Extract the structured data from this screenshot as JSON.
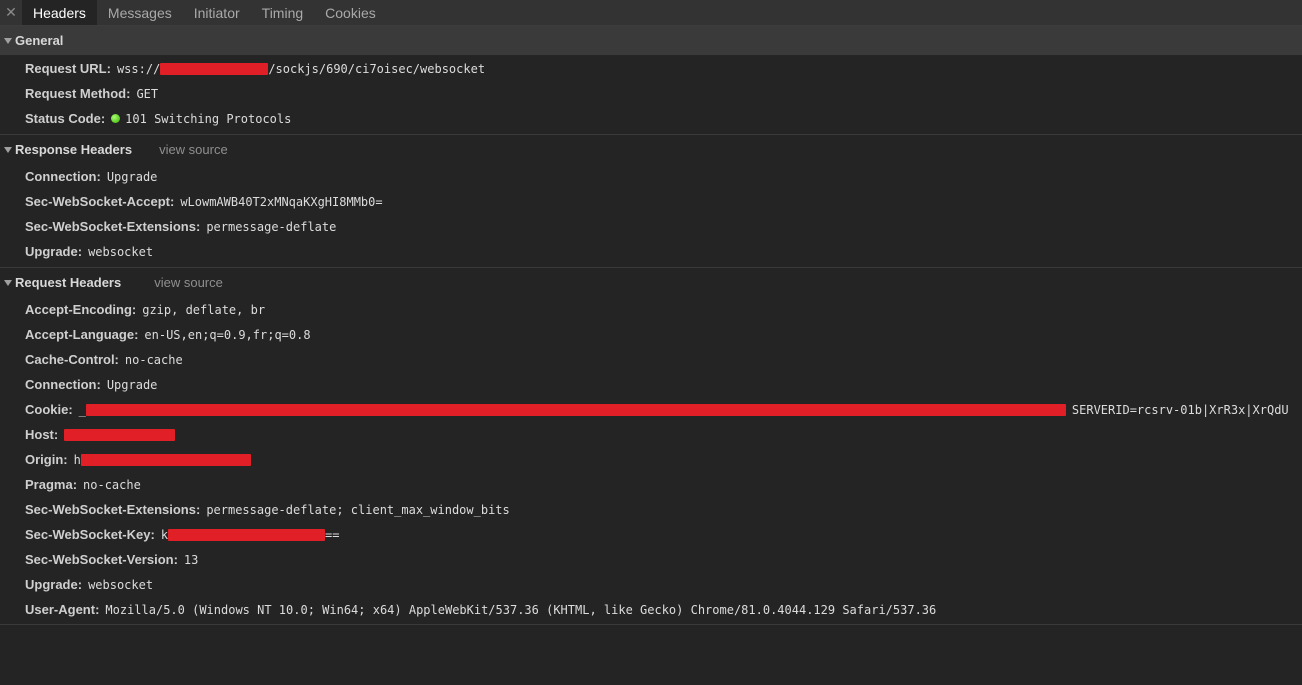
{
  "tabs": [
    "Headers",
    "Messages",
    "Initiator",
    "Timing",
    "Cookies"
  ],
  "close_glyph": "✕",
  "general": {
    "title": "General",
    "request_url": {
      "key": "Request URL:",
      "prefix": "wss://",
      "suffix": "/sockjs/690/ci7oisec/websocket"
    },
    "request_method": {
      "key": "Request Method:",
      "value": "GET"
    },
    "status_code": {
      "key": "Status Code:",
      "value": "101 Switching Protocols",
      "status_color": "#38b000"
    }
  },
  "response_headers": {
    "title": "Response Headers",
    "view_source": "view source",
    "rows": [
      {
        "key": "Connection:",
        "value": "Upgrade"
      },
      {
        "key": "Sec-WebSocket-Accept:",
        "value": "wLowmAWB40T2xMNqaKXgHI8MMb0="
      },
      {
        "key": "Sec-WebSocket-Extensions:",
        "value": "permessage-deflate"
      },
      {
        "key": "Upgrade:",
        "value": "websocket"
      }
    ]
  },
  "request_headers": {
    "title": "Request Headers",
    "view_source": "view source",
    "accept_encoding": {
      "key": "Accept-Encoding:",
      "value": "gzip, deflate, br"
    },
    "accept_language": {
      "key": "Accept-Language:",
      "value": "en-US,en;q=0.9,fr;q=0.8"
    },
    "cache_control": {
      "key": "Cache-Control:",
      "value": "no-cache"
    },
    "connection": {
      "key": "Connection:",
      "value": "Upgrade"
    },
    "cookie": {
      "key": "Cookie:",
      "prefix": "_",
      "suffix": "SERVERID=rcsrv-01b|XrR3x|XrQdU"
    },
    "host": {
      "key": "Host:"
    },
    "origin": {
      "key": "Origin:",
      "prefix": "h"
    },
    "pragma": {
      "key": "Pragma:",
      "value": "no-cache"
    },
    "ws_extensions": {
      "key": "Sec-WebSocket-Extensions:",
      "value": "permessage-deflate; client_max_window_bits"
    },
    "ws_key": {
      "key": "Sec-WebSocket-Key:",
      "prefix": "k",
      "suffix": "=="
    },
    "ws_version": {
      "key": "Sec-WebSocket-Version:",
      "value": "13"
    },
    "upgrade": {
      "key": "Upgrade:",
      "value": "websocket"
    },
    "user_agent": {
      "key": "User-Agent:",
      "value": "Mozilla/5.0 (Windows NT 10.0; Win64; x64) AppleWebKit/537.36 (KHTML, like Gecko) Chrome/81.0.4044.129 Safari/537.36"
    }
  },
  "colors": {
    "redaction": "#e01f26",
    "background": "#242424",
    "tabbar": "#333333"
  }
}
